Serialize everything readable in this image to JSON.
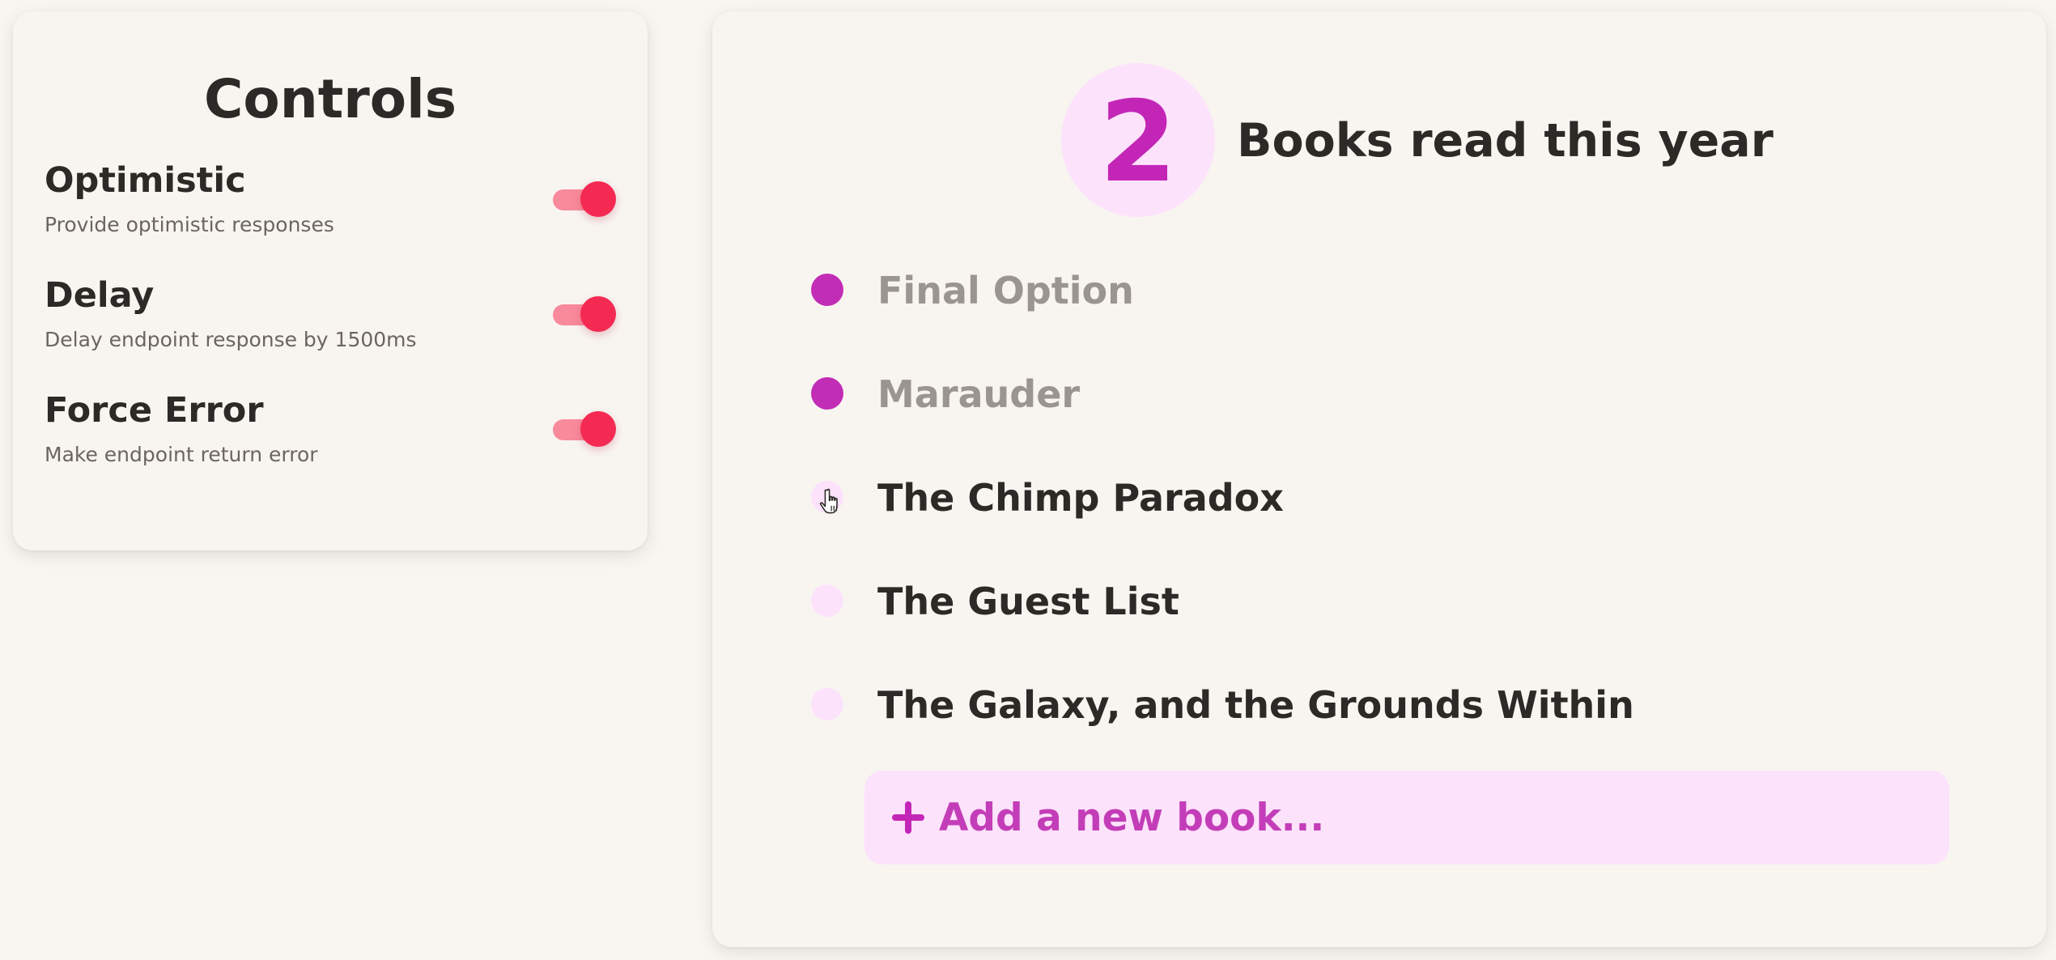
{
  "controls": {
    "title": "Controls",
    "items": [
      {
        "label": "Optimistic",
        "description": "Provide optimistic responses",
        "enabled": true
      },
      {
        "label": "Delay",
        "description": "Delay endpoint response by 1500ms",
        "enabled": true
      },
      {
        "label": "Force Error",
        "description": "Make endpoint return error",
        "enabled": true
      }
    ],
    "toggle_colors": {
      "track": "#f88a9b",
      "knob": "#f42a53"
    }
  },
  "books": {
    "count": "2",
    "count_label": "Books read this year",
    "items": [
      {
        "title": "Final Option",
        "read": true
      },
      {
        "title": "Marauder",
        "read": true
      },
      {
        "title": "The Chimp Paradox",
        "read": false
      },
      {
        "title": "The Guest List",
        "read": false
      },
      {
        "title": "The Galaxy, and the Grounds Within",
        "read": false
      }
    ],
    "add_label": "Add a new book...",
    "accent_color": "#c326b7",
    "accent_light": "#fde2fb",
    "hovered_item_icon": "hand-pointer-icon"
  }
}
